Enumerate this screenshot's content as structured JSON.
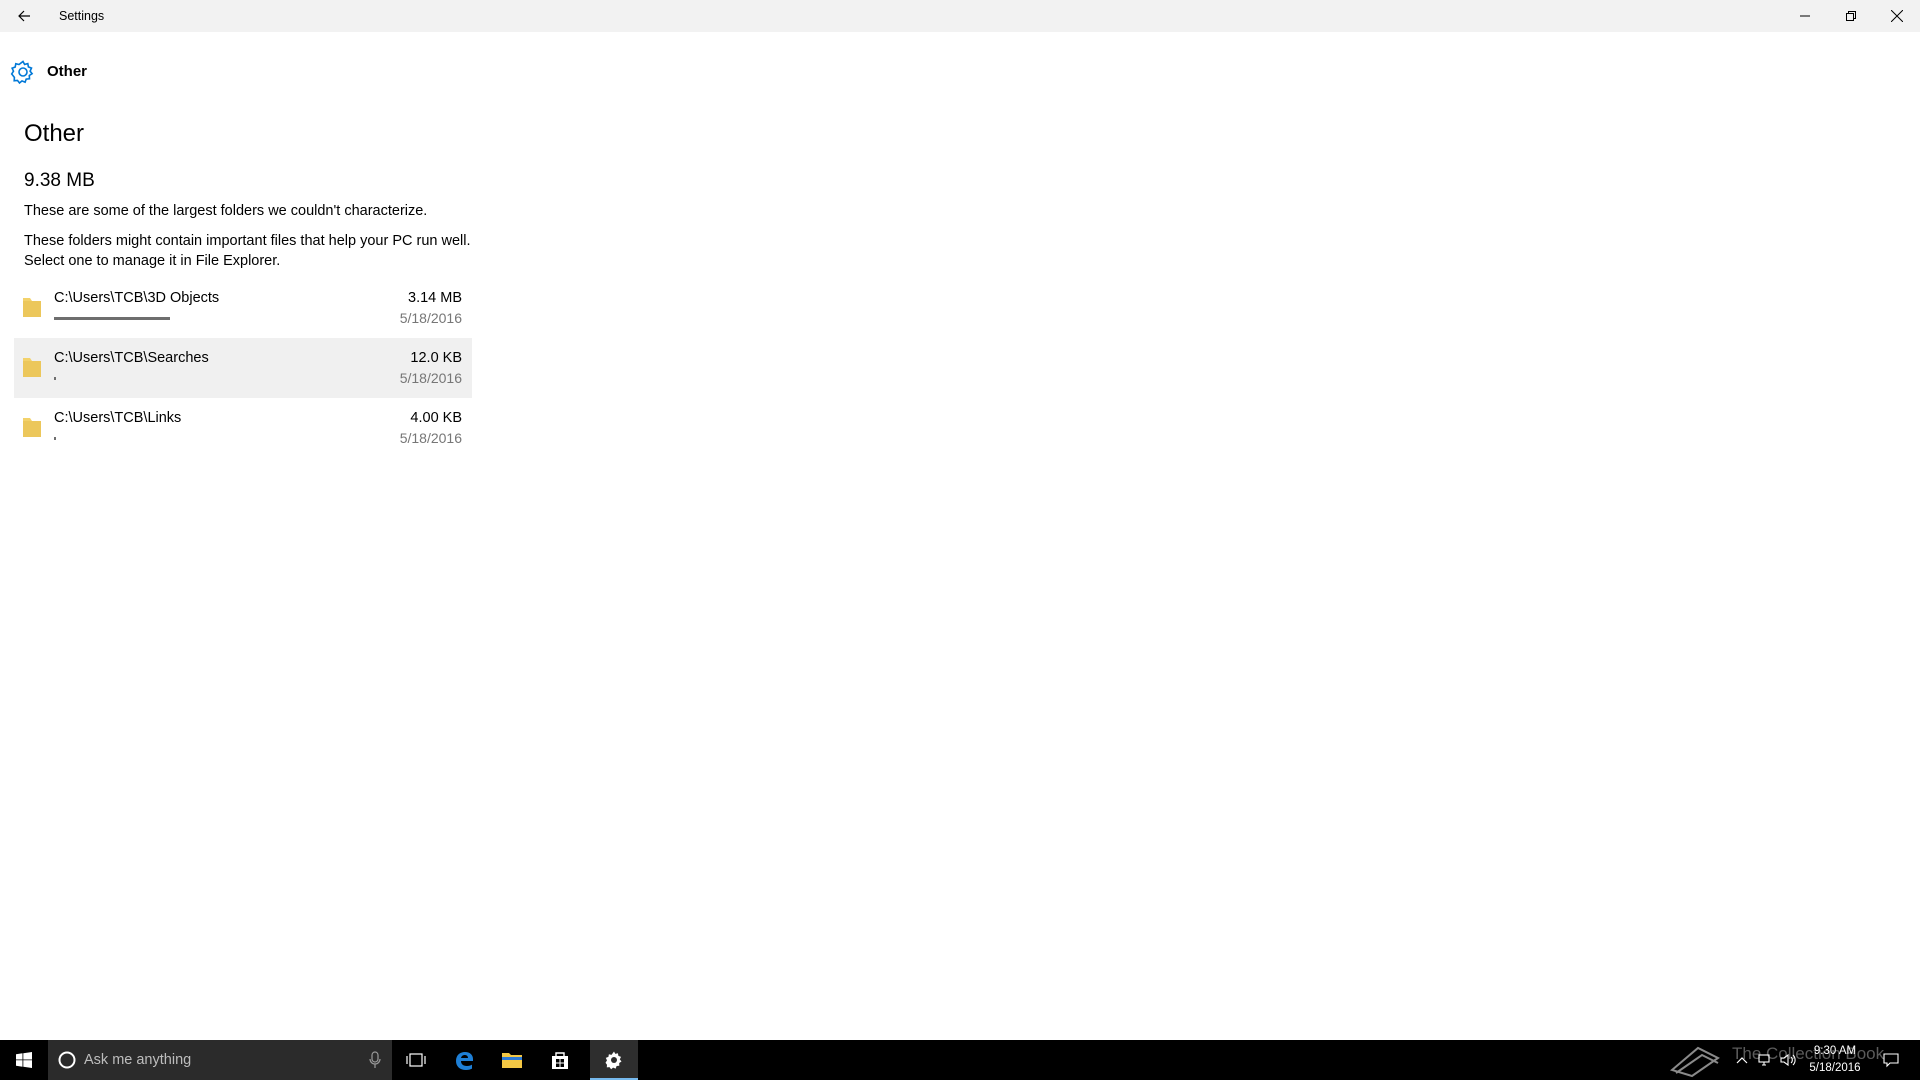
{
  "window": {
    "title": "Settings",
    "header_label": "Other"
  },
  "page": {
    "title": "Other",
    "total_size": "9.38 MB",
    "description_1": "These are some of the largest folders we couldn't characterize.",
    "description_2": "These folders might contain important files that help your PC run well. Select one to manage it in File Explorer."
  },
  "folders": [
    {
      "path": "C:\\Users\\TCB\\3D Objects",
      "size": "3.14 MB",
      "date": "5/18/2016",
      "usage_fraction": 0.33
    },
    {
      "path": "C:\\Users\\TCB\\Searches",
      "size": "12.0 KB",
      "date": "5/18/2016",
      "usage_fraction": 0.006
    },
    {
      "path": "C:\\Users\\TCB\\Links",
      "size": "4.00 KB",
      "date": "5/18/2016",
      "usage_fraction": 0.006
    }
  ],
  "taskbar": {
    "search_placeholder": "Ask me anything",
    "apps": [
      "task-view",
      "edge",
      "file-explorer",
      "store",
      "settings"
    ],
    "active_app": "settings",
    "clock_time": "9:30 AM",
    "clock_date": "5/18/2016",
    "watermark": "The Collection Book"
  },
  "colors": {
    "accent": "#0078d7",
    "folder": "#f3d26b",
    "hover_row": "#f0f0f0",
    "taskbar": "#000000",
    "active_indicator": "#76b9ed"
  }
}
